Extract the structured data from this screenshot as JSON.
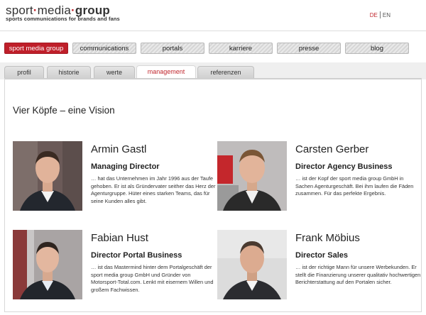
{
  "header": {
    "logo_part1": "sport",
    "logo_part2": "media",
    "logo_part3": "group",
    "tagline": "sports communications for brands and fans",
    "lang_de": "DE",
    "lang_en": "EN"
  },
  "mainnav": {
    "items": [
      {
        "label": "sport media group"
      },
      {
        "label": "communications"
      },
      {
        "label": "portals"
      },
      {
        "label": "karriere"
      },
      {
        "label": "presse"
      },
      {
        "label": "blog"
      }
    ]
  },
  "subnav": {
    "items": [
      {
        "label": "profil"
      },
      {
        "label": "historie"
      },
      {
        "label": "werte"
      },
      {
        "label": "management"
      },
      {
        "label": "referenzen"
      }
    ]
  },
  "main": {
    "heading": "Vier Köpfe – eine Vision",
    "people": [
      {
        "name": "Armin Gastl",
        "role": "Managing Director",
        "desc": "… hat das Unternehmen im Jahr 1996 aus der Taufe gehoben. Er ist als Gründervater seither das Herz der Agenturgruppe. Hüter eines starken Teams, das für seine Kunden alles gibt."
      },
      {
        "name": "Carsten Gerber",
        "role": "Director Agency Business",
        "desc": "… ist der Kopf der sport media group GmbH in Sachen Agenturgeschäft. Bei ihm laufen die Fäden zusammen. Für das perfekte Ergebnis."
      },
      {
        "name": "Fabian Hust",
        "role": "Director Portal Business",
        "desc": "… ist das Mastermind hinter dem Portalgeschäft der sport media group GmbH und Gründer von Motorsport-Total.com. Lenkt mit eisernem Willen und großem Fachwissen."
      },
      {
        "name": "Frank Möbius",
        "role": "Director Sales",
        "desc": "… ist der richtige Mann für unsere Werbekunden. Er stellt die Finanzierung unserer qualitativ hochwertigen Berichterstattung auf den Portalen sicher."
      }
    ]
  }
}
